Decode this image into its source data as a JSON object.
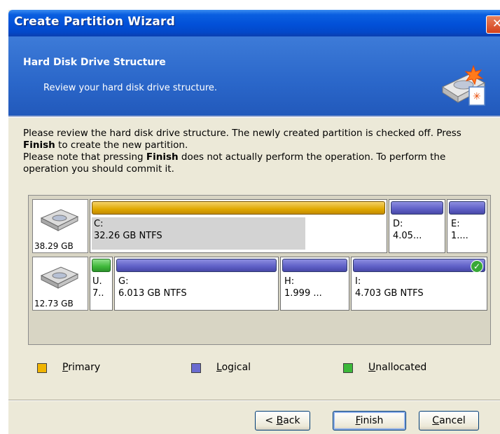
{
  "window": {
    "title": "Create Partition Wizard",
    "close_glyph": "✕"
  },
  "header": {
    "title": "Hard Disk Drive Structure",
    "subtitle": "Review your hard disk drive structure.",
    "icon": "disk-wizard-icon"
  },
  "description": {
    "line1_a": "Please review the hard disk drive structure. The newly created partition is checked off. Press ",
    "line1_bold": "Finish",
    "line1_b": " to create the new partition.",
    "line2_a": "Please note that pressing ",
    "line2_bold": "Finish",
    "line2_b": " does not actually perform the operation. To perform the operation you should commit it."
  },
  "disks": [
    {
      "size": "38.29 GB",
      "partitions": [
        {
          "id": "C",
          "type": "primary",
          "label": "C:",
          "detail": "32.26 GB  NTFS",
          "used_fraction": 0.72
        },
        {
          "id": "D",
          "type": "logical",
          "label": "D:",
          "detail": "4.05..."
        },
        {
          "id": "E",
          "type": "logical",
          "label": "E:",
          "detail": "1...."
        }
      ]
    },
    {
      "size": "12.73 GB",
      "partitions": [
        {
          "id": "U",
          "type": "unallocated",
          "label": "U.",
          "detail": "7.."
        },
        {
          "id": "G",
          "type": "logical",
          "label": "G:",
          "detail": "6.013 GB  NTFS"
        },
        {
          "id": "H",
          "type": "logical",
          "label": "H:",
          "detail": "1.999 ..."
        },
        {
          "id": "I",
          "type": "logical",
          "label": "I:",
          "detail": "4.703 GB  NTFS",
          "checked": true
        }
      ]
    }
  ],
  "legend": [
    {
      "type": "primary",
      "accel": "P",
      "rest": "rimary",
      "color": "#f0b400"
    },
    {
      "type": "logical",
      "accel": "L",
      "rest": "ogical",
      "color": "#6a6bd0"
    },
    {
      "type": "unallocated",
      "accel": "U",
      "rest": "nallocated",
      "color": "#3cb83a"
    }
  ],
  "buttons": {
    "back": {
      "prefix": "< ",
      "accel": "B",
      "rest": "ack"
    },
    "finish": {
      "accel": "F",
      "rest": "inish"
    },
    "cancel": {
      "accel": "C",
      "rest": "ancel"
    }
  }
}
